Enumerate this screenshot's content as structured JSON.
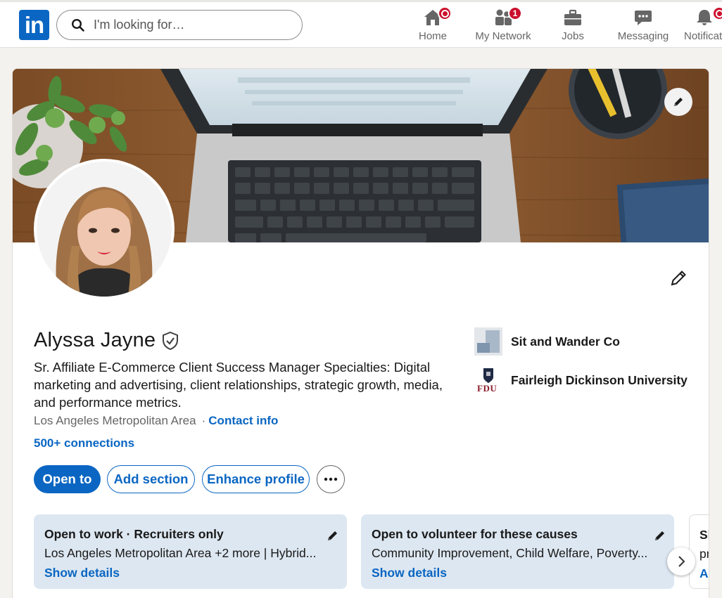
{
  "nav": {
    "search_placeholder": "I'm looking for…",
    "items": [
      {
        "label": "Home",
        "badge": ""
      },
      {
        "label": "My Network",
        "badge": "1"
      },
      {
        "label": "Jobs",
        "badge": ""
      },
      {
        "label": "Messaging",
        "badge": ""
      },
      {
        "label": "Notifications",
        "badge": ""
      }
    ]
  },
  "profile": {
    "name": "Alyssa Jayne",
    "headline": "Sr. Affiliate E-Commerce Client Success Manager Specialties: Digital marketing and advertising, client relationships, strategic growth, media, and performance metrics.",
    "location": "Los Angeles Metropolitan Area",
    "separator": "·",
    "contact_info": "Contact info",
    "connections": "500+ connections"
  },
  "actions": {
    "open_to": "Open to",
    "add_section": "Add section",
    "enhance_profile": "Enhance profile"
  },
  "orgs": {
    "company": "Sit and Wander Co",
    "school": "Fairleigh Dickinson University",
    "school_logo_text": "FDU"
  },
  "open_cards": [
    {
      "title": "Open to work · Recruiters only",
      "desc": "Los Angeles Metropolitan Area +2 more | Hybrid...",
      "link": "Show details"
    },
    {
      "title": "Open to volunteer for these causes",
      "desc": "Community Improvement, Child Welfare, Poverty...",
      "link": "Show details"
    },
    {
      "title": "Sh",
      "desc": "pr",
      "link": "Ac"
    }
  ],
  "colors": {
    "brand": "#0a66c2",
    "badge": "#cb112d",
    "card_bg": "#dde7f1"
  }
}
